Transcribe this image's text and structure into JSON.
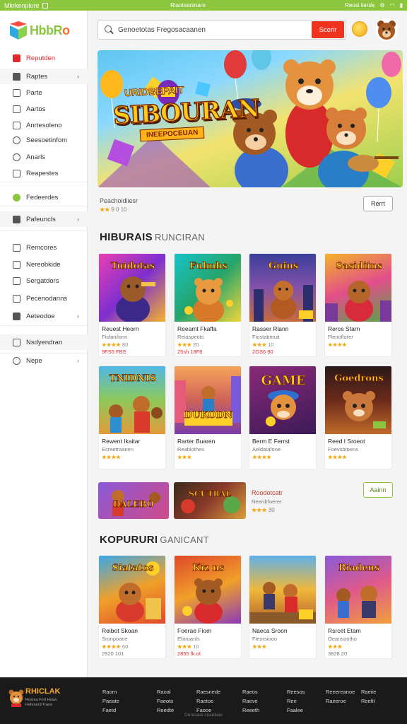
{
  "status_bar": {
    "left": "Mkrkenplore",
    "center": "Riaoteaninare",
    "right": "Reosi lierde"
  },
  "sidebar": {
    "logo": "HbbR",
    "logo_accent": "o",
    "items": [
      {
        "label": "Reputden",
        "icon": "home-icon"
      },
      {
        "label": "Raptes",
        "icon": "grid-icon",
        "chevron": "›"
      },
      {
        "label": "Parte",
        "icon": "square-icon"
      },
      {
        "label": "Aartos",
        "icon": "square-icon"
      },
      {
        "label": "Anrtesoleno",
        "icon": "square-icon"
      },
      {
        "label": "Seesoetinfom",
        "icon": "people-icon"
      },
      {
        "label": "Anarls",
        "icon": "people-icon"
      },
      {
        "label": "Reapestes",
        "icon": "square-icon"
      },
      {
        "label": "Fedeerdes",
        "icon": "globe-icon"
      },
      {
        "label": "Pafeuncls",
        "icon": "chart-icon",
        "chevron": "›"
      },
      {
        "label": "Remcores",
        "icon": "square-icon"
      },
      {
        "label": "Nereobkide",
        "icon": "square-icon"
      },
      {
        "label": "Sergatdors",
        "icon": "square-icon"
      },
      {
        "label": "Pecenodanns",
        "icon": "square-icon"
      },
      {
        "label": "Aeteodoe",
        "icon": "folder-icon",
        "chevron": "›"
      },
      {
        "label": "Nsdyendran",
        "icon": "square-icon"
      },
      {
        "label": "Nepe",
        "icon": "circle-icon",
        "chevron": "›"
      }
    ]
  },
  "search": {
    "placeholder": "Genoetotas Fregosacaanen",
    "button": "Scerir"
  },
  "hero": {
    "kicker": "URIDBEPAIT",
    "title": "SIBOURAN",
    "subtitle": "INEEPOCEUAN"
  },
  "hero_meta": {
    "title": "Peachoidiiesr",
    "rating": "★★",
    "count": "9 0 10",
    "button": "Rerrt"
  },
  "sections": {
    "first": {
      "title": "HIBURAIS",
      "title_light": "RUNCIRAN"
    },
    "second": {
      "title": "KOPURURI",
      "title_light": "GANICANT"
    }
  },
  "cards_row1": [
    {
      "thumb": "Tuidotas",
      "name": "Reuest Heorn",
      "cat": "Fisfanilonn",
      "rating": "★★★★",
      "count": "80",
      "price": "9FS5 FBS"
    },
    {
      "thumb": "Fulmbs",
      "name": "Reeamt Fkaffa",
      "cat": "Reiaspeots",
      "rating": "★★★",
      "count": "20",
      "price": "25sh 18F8"
    },
    {
      "thumb": "Guins",
      "name": "Rasser Rlann",
      "cat": "Fiostabmuit",
      "rating": "★★★",
      "count": "10",
      "price": "2GS6 80"
    },
    {
      "thumb": "Sasidiins",
      "name": "Rerce Starn",
      "cat": "Flenoflorer",
      "rating": "★★★★",
      "count": "",
      "price": ""
    }
  ],
  "cards_row2": [
    {
      "thumb": "TNIDNIS",
      "name": "Rewent Ikaitar",
      "cat": "Esreetraanen",
      "rating": "★★★★",
      "count": "",
      "price": ""
    },
    {
      "thumb": "DUKODN",
      "name": "Rarter Buaren",
      "cat": "Reabiothes",
      "rating": "★★★",
      "count": "",
      "price": ""
    },
    {
      "thumb": "GAME",
      "name": "Berm E Ferrst",
      "cat": "Aeldatafone",
      "rating": "★★★★",
      "count": "",
      "price": ""
    },
    {
      "thumb": "Goedrons",
      "name": "Reed I Sroeot",
      "cat": "Foevsbtoens",
      "rating": "★★★★",
      "count": "",
      "price": ""
    }
  ],
  "promo": {
    "thumb1": "DALEBO",
    "thumb2": "SCUTRAL",
    "title": "Roodotcatr",
    "cat": "Neerdrfoerer",
    "rating": "★★★",
    "count": "30",
    "button": "Aainn"
  },
  "cards_row3": [
    {
      "thumb": "Siatatos",
      "name": "Reibot Skoan",
      "cat": "Sronpoane",
      "rating": "★★★★",
      "count": "60",
      "price": "2920 101"
    },
    {
      "thumb": "Kiz ns",
      "name": "Foerae Fiom",
      "cat": "Efaroanls",
      "rating": "★★★",
      "count": "10",
      "price": "2855 fk.ot"
    },
    {
      "thumb": "",
      "name": "Naeca Sroon",
      "cat": "Fieorsiooo",
      "rating": "★★★",
      "count": "",
      "price": ""
    },
    {
      "thumb": "Riadens",
      "name": "Rsrcet Etam",
      "cat": "Oeansootho",
      "rating": "★★★",
      "count": "",
      "price": "3828 20"
    }
  ],
  "footer": {
    "logo": "RHICLAK",
    "tagline": "Rosrea Fort Hesw Hefenerd Trane",
    "cols": [
      [
        "Raorn",
        "Paeate",
        "Faetd"
      ],
      [
        "Raoal",
        "Faeoto",
        "Reedte"
      ],
      [
        "Raesnede",
        "Raetoe",
        "Faooe"
      ],
      [
        "Raeos",
        "Raeve",
        "Reeeth"
      ],
      [
        "Reesos",
        "Ree",
        "Faalee"
      ],
      [
        "Reeereanoe",
        "Raeeroe"
      ],
      [
        "Raeiie",
        "Reefit"
      ]
    ],
    "copyright": "Dereoaei snaelieie"
  }
}
